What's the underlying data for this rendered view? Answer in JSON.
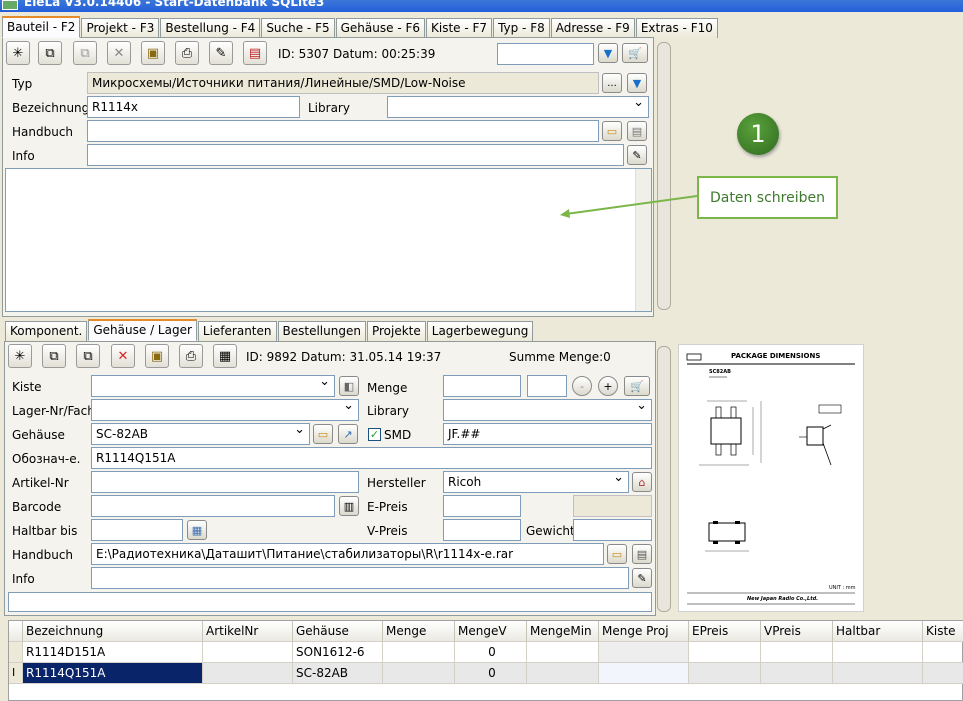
{
  "window": {
    "title": "EleLa V3.0.14406 - Start-Datenbank SQLite3"
  },
  "main_tabs": [
    "Bauteil - F2",
    "Projekt - F3",
    "Bestellung - F4",
    "Suche - F5",
    "Gehäuse - F6",
    "Kiste - F7",
    "Typ - F8",
    "Adresse - F9",
    "Extras - F10"
  ],
  "top": {
    "id_text": "ID: 5307  Datum: 00:25:39",
    "search_value": "",
    "typ_label": "Typ",
    "typ_value": "Микросхемы/Источники питания/Линейные/SMD/Low-Noise",
    "typ_btn": "...",
    "bezeichnung_label": "Bezeichnung",
    "bezeichnung_value": "R1114x",
    "library_label": "Library",
    "library_value": "",
    "handbuch_label": "Handbuch",
    "handbuch_value": "",
    "info_label": "Info",
    "info_value": "",
    "notes": ""
  },
  "callout": {
    "number": "1",
    "text": "Daten schreiben",
    "color": "#7ab648"
  },
  "sub_tabs": [
    "Komponent.",
    "Gehäuse / Lager",
    "Lieferanten",
    "Bestellungen",
    "Projekte",
    "Lagerbewegung"
  ],
  "lower": {
    "id_text": "ID: 9892  Datum: 31.05.14 19:37",
    "summe": "Summe Menge:0",
    "kiste_label": "Kiste",
    "kiste_value": "",
    "menge_label": "Menge",
    "menge_value": "",
    "menge_step": "",
    "minus": "-",
    "plus": "+",
    "lager_label": "Lager-Nr/Fach",
    "lager_value": "",
    "library_label": "Library",
    "library_value": "",
    "gehaeuse_label": "Gehäuse",
    "gehaeuse_value": "SC-82AB",
    "smd_label": "SMD",
    "smd_checked": "✓",
    "smd_code": "JF.##",
    "oboz_label": "Обознач-е.",
    "oboz_value": "R1114Q151A",
    "artikel_label": "Artikel-Nr",
    "artikel_value": "",
    "hersteller_label": "Hersteller",
    "hersteller_value": "Ricoh",
    "barcode_label": "Barcode",
    "barcode_value": "",
    "epreis_label": "E-Preis",
    "epreis_value": "",
    "haltbar_label": "Haltbar bis",
    "haltbar_value": "",
    "vpreis_label": "V-Preis",
    "vpreis_value": "",
    "gewicht_label": "Gewicht",
    "gewicht_value": "",
    "handbuch_label": "Handbuch",
    "handbuch_value": "E:\\Радиотехника\\Даташит\\Питание\\стабилизаторы\\R\\r1114x-e.rar",
    "info_label": "Info",
    "info_value": "",
    "status": ""
  },
  "package": {
    "title": "PACKAGE DIMENSIONS",
    "subtitle": "SC82AB",
    "unit": "UNIT : mm",
    "maker": "New Japan Radio Co.,Ltd."
  },
  "table": {
    "columns": [
      "Bezeichnung",
      "ArtikelNr",
      "Gehäuse",
      "Menge",
      "MengeV",
      "MengeMin",
      "Menge Proj",
      "EPreis",
      "VPreis",
      "Haltbar",
      "Kiste"
    ],
    "rows": [
      [
        "R1114D151A",
        "",
        "SON1612-6",
        "",
        "0",
        "",
        "",
        "",
        "",
        "",
        ""
      ],
      [
        "R1114Q151A",
        "",
        "SC-82AB",
        "",
        "0",
        "",
        "",
        "",
        "",
        "",
        ""
      ]
    ]
  }
}
